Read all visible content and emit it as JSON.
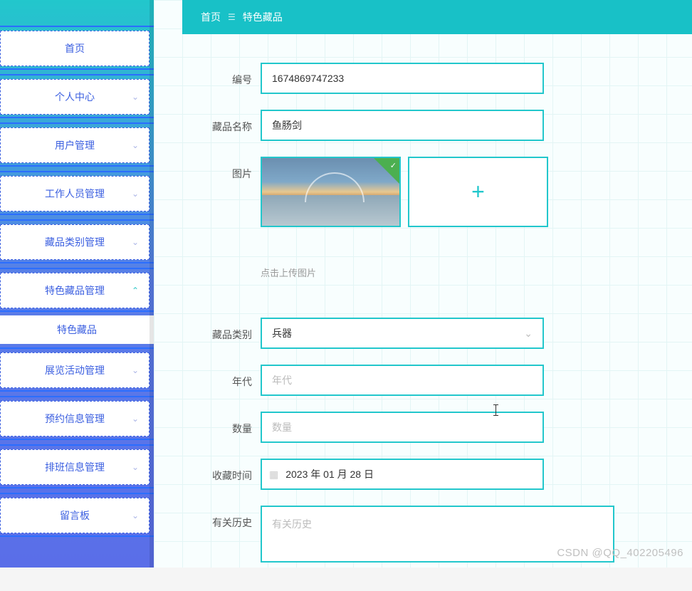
{
  "sidebar": {
    "items": [
      {
        "label": "首页",
        "expandable": false
      },
      {
        "label": "个人中心",
        "expandable": true,
        "expanded": false
      },
      {
        "label": "用户管理",
        "expandable": true,
        "expanded": false
      },
      {
        "label": "工作人员管理",
        "expandable": true,
        "expanded": false
      },
      {
        "label": "藏品类别管理",
        "expandable": true,
        "expanded": false
      },
      {
        "label": "特色藏品管理",
        "expandable": true,
        "expanded": true
      },
      {
        "label": "展览活动管理",
        "expandable": true,
        "expanded": false
      },
      {
        "label": "预约信息管理",
        "expandable": true,
        "expanded": false
      },
      {
        "label": "排班信息管理",
        "expandable": true,
        "expanded": false
      },
      {
        "label": "留言板",
        "expandable": true,
        "expanded": false
      }
    ],
    "submenu": {
      "label": "特色藏品"
    }
  },
  "breadcrumb": {
    "home": "首页",
    "current": "特色藏品"
  },
  "form": {
    "id_label": "编号",
    "id_value": "1674869747233",
    "name_label": "藏品名称",
    "name_value": "鱼肠剑",
    "image_label": "图片",
    "upload_hint": "点击上传图片",
    "category_label": "藏品类别",
    "category_value": "兵器",
    "era_label": "年代",
    "era_placeholder": "年代",
    "quantity_label": "数量",
    "quantity_placeholder": "数量",
    "collect_time_label": "收藏时间",
    "collect_time_value": "2023 年 01 月 28 日",
    "history_label": "有关历史",
    "history_placeholder": "有关历史"
  },
  "watermark": "CSDN @QQ_402205496"
}
